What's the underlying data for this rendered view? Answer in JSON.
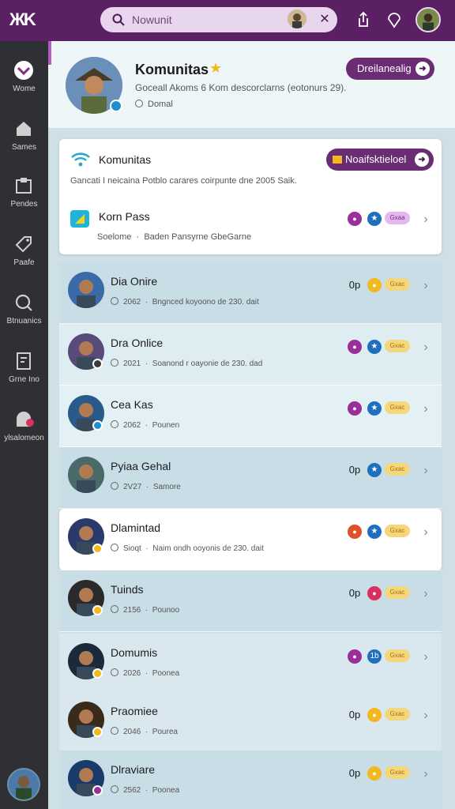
{
  "app": {
    "logo": "ЖK"
  },
  "search": {
    "value": "Nowunit"
  },
  "sidebar": {
    "items": [
      {
        "label": "Wome",
        "icon": "home-brand-icon"
      },
      {
        "label": "Sames",
        "icon": "building-icon"
      },
      {
        "label": "Pendes",
        "icon": "puzzle-icon"
      },
      {
        "label": "Paafe",
        "icon": "tag-icon"
      },
      {
        "label": "Btnuanics",
        "icon": "search-circle-icon"
      },
      {
        "label": "Grne Ino",
        "icon": "document-icon"
      },
      {
        "label": "ylsalomeon",
        "icon": "ghost-icon"
      }
    ]
  },
  "header": {
    "title": "Komunitas",
    "description": "Goceall Akoms 6 Kom descorclarns (eotonurs 29).",
    "sub": "Domal",
    "button": "Dreilanealig"
  },
  "card": {
    "title": "Komunitas",
    "button": "Noaifsktieloel",
    "description": "Gancati I neicaina Potblo carares coirpunte dne 2005 Saik.",
    "pass_title": "Korn Pass",
    "pass_sub_a": "Soelome",
    "pass_sub_b": "Baden Pansyrne GbeGarne",
    "pass_tag": "Gxaa"
  },
  "rows": [
    {
      "name": "Dia Onire",
      "date": "2062",
      "desc": "Bngnced koyoono de 230. dait",
      "status": "0p",
      "tag": "Gxac",
      "dot_color": "#f2b81d",
      "blue_glyph": "★",
      "badge_color": ""
    },
    {
      "name": "Dra Onlice",
      "date": "2021",
      "desc": "Soanond r oayonie de 230. dad",
      "status": "",
      "tag": "Gxac",
      "dot_color": "#9a2e9b",
      "blue_glyph": "★",
      "badge_color": "#3a3a3a"
    },
    {
      "name": "Cea Kas",
      "date": "2062",
      "desc": "Pounen",
      "status": "",
      "tag": "Gxac",
      "dot_color": "#9a2e9b",
      "blue_glyph": "★",
      "badge_color": "#1f8fd0"
    },
    {
      "name": "Pyiaa Gehal",
      "date": "2V27",
      "desc": "Samore",
      "status": "0p",
      "tag": "Gxac",
      "dot_color": "",
      "blue_glyph": "★",
      "badge_color": ""
    },
    {
      "name": "Dlamintad",
      "date": "Sioqt",
      "desc": "Naim ondh ooyonis de 230. dait",
      "status": "",
      "tag": "Gxac",
      "dot_color": "#e0502a",
      "blue_glyph": "★",
      "badge_color": "#f2b81d"
    },
    {
      "name": "Tuinds",
      "date": "2156",
      "desc": "Pounoo",
      "status": "0p",
      "tag": "Gxac",
      "dot_color": "#d9305f",
      "blue_glyph": "✕",
      "badge_color": "#f2b81d"
    },
    {
      "name": "Domumis",
      "date": "2026",
      "desc": "Poonea",
      "status": "",
      "tag": "Gxac",
      "dot_color": "#9a2e9b",
      "blue_glyph": "1b",
      "badge_color": "#f2b81d"
    },
    {
      "name": "Praomiee",
      "date": "2046",
      "desc": "Pourea",
      "status": "0p",
      "tag": "Gxac",
      "dot_color": "#f2b81d",
      "blue_glyph": "★",
      "badge_color": "#f2b81d"
    },
    {
      "name": "Dlraviare",
      "date": "2562",
      "desc": "Poonea",
      "status": "0p",
      "tag": "Gxac",
      "dot_color": "#f2b81d",
      "blue_glyph": "★",
      "badge_color": "#9a2e9b"
    }
  ],
  "colors": {
    "topbar": "#5b1f63",
    "sidebar": "#2f3033",
    "accent": "#6a2c73",
    "star": "#f2b81d"
  }
}
